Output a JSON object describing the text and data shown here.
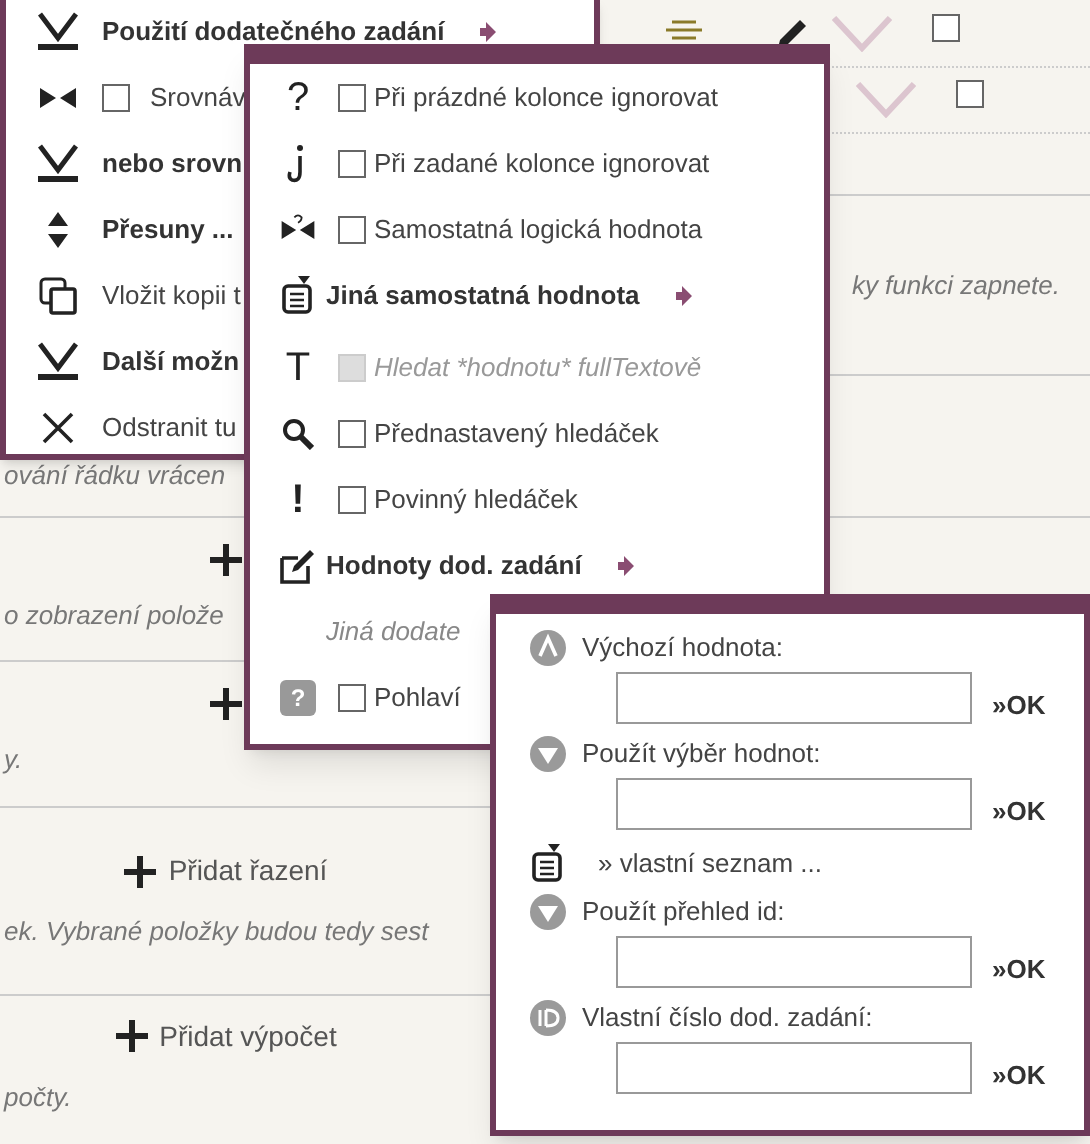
{
  "row_controls": [
    {
      "kind": "full",
      "checked": false
    },
    {
      "kind": "partial",
      "checked": false
    }
  ],
  "sections": [
    {
      "kind": "note-right",
      "note": "ky funkci zapnete."
    },
    {
      "kind": "note-top",
      "note": "ování řádku vrácen"
    },
    {
      "kind": "add",
      "note": "o zobrazení polože"
    },
    {
      "kind": "add",
      "note": "y."
    },
    {
      "kind": "add",
      "button": "Přidat řazení",
      "note": "ek. Vybrané položky budou tedy sest"
    },
    {
      "kind": "add",
      "button": "Přidat výpočet",
      "note": "počty."
    }
  ],
  "menu_1": {
    "items": [
      {
        "kind": "submenu",
        "label": "Použití dodatečného zadání"
      },
      {
        "kind": "check",
        "label": "Srovnáv",
        "checked": false
      },
      {
        "kind": "heading",
        "label": "nebo srovn"
      },
      {
        "kind": "heading",
        "label": "Přesuny ..."
      },
      {
        "kind": "action",
        "label": "Vložit kopii t"
      },
      {
        "kind": "heading",
        "label": "Další možn"
      },
      {
        "kind": "action",
        "label": "Odstranit tu"
      }
    ]
  },
  "menu_2": {
    "items": [
      {
        "kind": "check",
        "icon_char": "?",
        "label": "Při prázdné kolonce ignorovat",
        "checked": false,
        "disabled": false
      },
      {
        "kind": "check",
        "label": "Při zadané kolonce ignorovat",
        "checked": false,
        "disabled": false
      },
      {
        "kind": "check",
        "label": "Samostatná logická hodnota",
        "checked": false,
        "disabled": false
      },
      {
        "kind": "submenu",
        "label": "Jiná samostatná hodnota"
      },
      {
        "kind": "check",
        "icon_char": "T",
        "label": "Hledat *hodnotu* fullTextově",
        "checked": false,
        "disabled": true
      },
      {
        "kind": "check",
        "label": "Přednastavený hledáček",
        "checked": false,
        "disabled": false
      },
      {
        "kind": "check",
        "icon_char": "!",
        "label": "Povinný hledáček",
        "checked": false,
        "disabled": false
      },
      {
        "kind": "submenu",
        "label": "Hodnoty dod. zadání"
      },
      {
        "kind": "note",
        "label": "Jiná dodate"
      },
      {
        "kind": "check",
        "icon_char": "?",
        "label": "Pohlaví",
        "checked": false,
        "disabled": false
      }
    ]
  },
  "menu_3": {
    "items": [
      {
        "kind": "field",
        "label": "Výchozí hodnota:",
        "button": "»OK"
      },
      {
        "kind": "field",
        "label": "Použít výběr hodnot:",
        "button": "»OK"
      },
      {
        "kind": "link",
        "label": "» vlastní seznam ..."
      },
      {
        "kind": "field",
        "label": "Použít přehled id:",
        "button": "»OK"
      },
      {
        "kind": "field",
        "label": "Vlastní číslo dod. zadání:",
        "button": "»OK"
      }
    ]
  }
}
